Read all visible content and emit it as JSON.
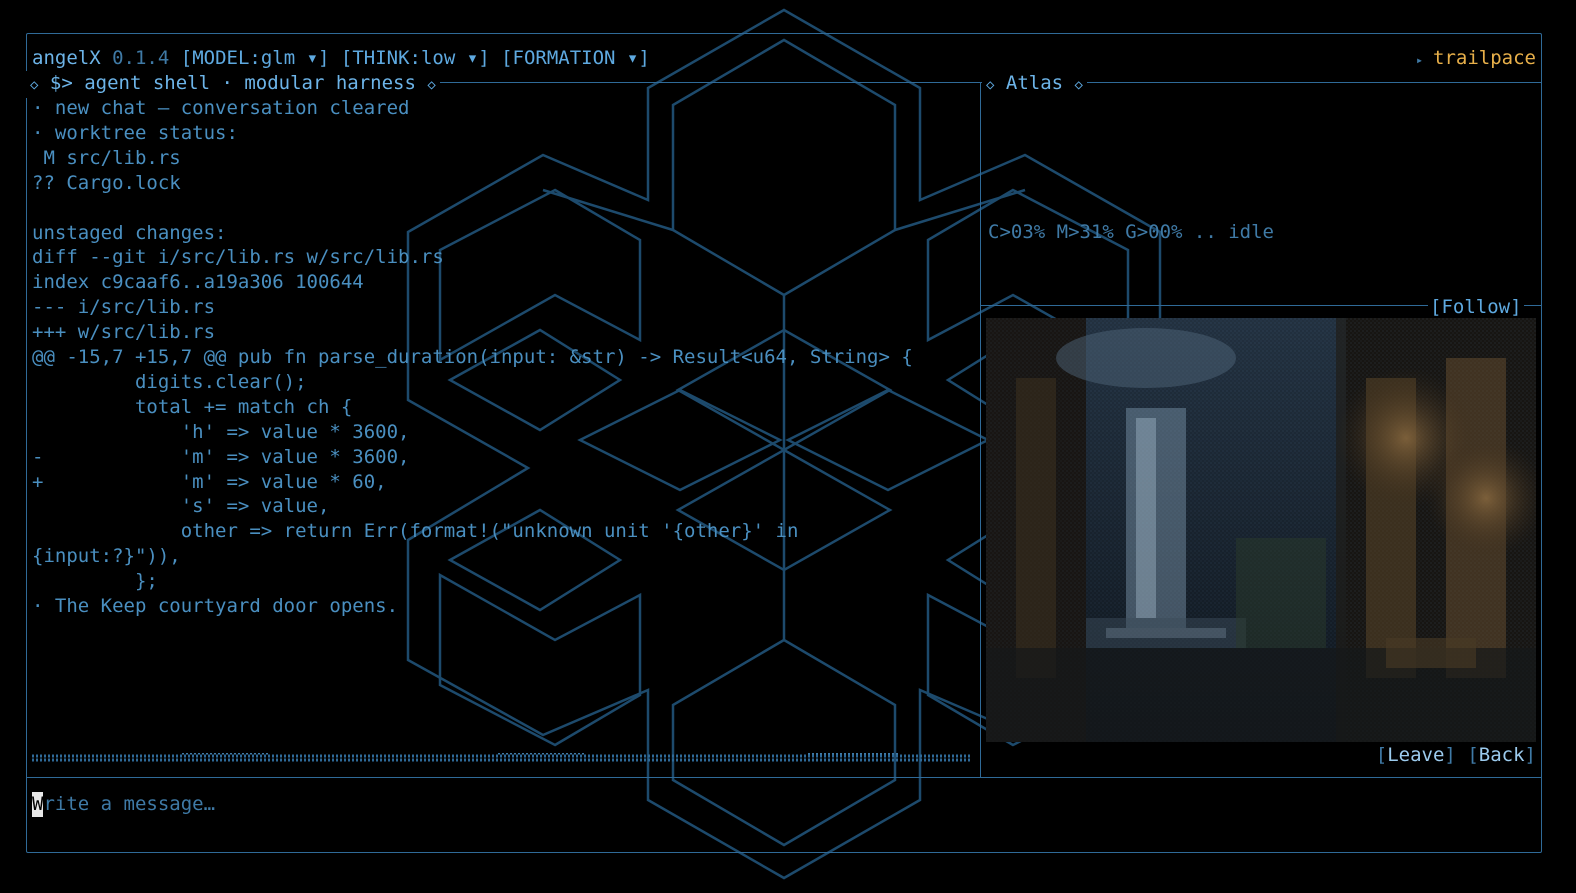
{
  "header": {
    "app_name": "angelX",
    "version": "0.1.4",
    "model_selector": "[MODEL:glm ▾]",
    "think_selector": "[THINK:low ▾]",
    "formation_selector": "[FORMATION ▾]",
    "user_name": "trailpace"
  },
  "shell_panel": {
    "title": "$> agent shell · modular harness",
    "lines": [
      "· new chat — conversation cleared",
      "· worktree status:",
      " M src/lib.rs",
      "?? Cargo.lock",
      "",
      "unstaged changes:",
      "diff --git i/src/lib.rs w/src/lib.rs",
      "index c9caaf6..a19a306 100644",
      "--- i/src/lib.rs",
      "+++ w/src/lib.rs",
      "@@ -15,7 +15,7 @@ pub fn parse_duration(input: &str) -> Result<u64, String> {",
      "         digits.clear();",
      "         total += match ch {",
      "             'h' => value * 3600,",
      "-            'm' => value * 3600,",
      "+            'm' => value * 60,",
      "             's' => value,",
      "             other => return Err(format!(\"unknown unit '{other}' in",
      "{input:?}\")),",
      "         };",
      "· The Keep courtyard door opens."
    ]
  },
  "atlas_panel": {
    "title": "Atlas",
    "status_text": "C>03% M>31% G>00% .. idle",
    "follow_label": "[Follow]",
    "leave_label": "Leave",
    "back_label": "Back"
  },
  "composer": {
    "placeholder_first": "W",
    "placeholder_rest": "rite a message…"
  },
  "colors": {
    "border": "#2f6a98",
    "text": "#4a8fc0",
    "accent_user": "#e8b04a"
  }
}
